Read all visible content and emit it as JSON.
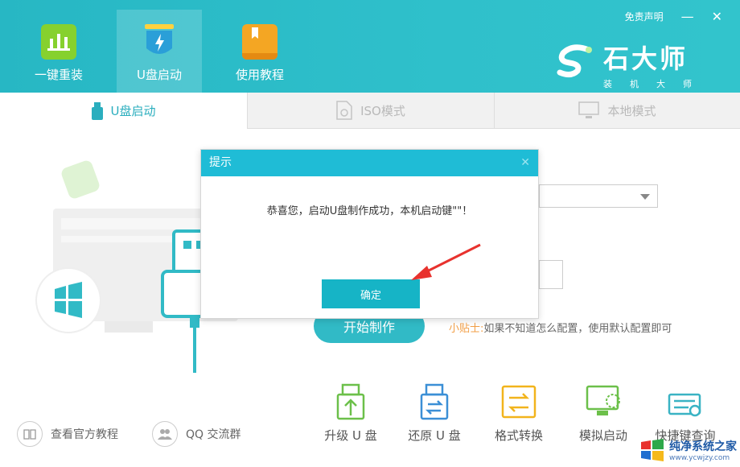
{
  "nav": [
    {
      "label": "一键重装",
      "icon": "bar-chart-icon",
      "color": "#7fcf2f"
    },
    {
      "label": "U盘启动",
      "icon": "usb-shield-icon",
      "color": "#2ab5e0"
    },
    {
      "label": "使用教程",
      "icon": "book-icon",
      "color": "#f5a623"
    }
  ],
  "topbar": {
    "disclaimer": "免责声明",
    "minimize": "—",
    "close": "✕"
  },
  "brand": {
    "name": "石大师",
    "sub": "装机大师"
  },
  "tabs": [
    {
      "label": "U盘启动",
      "icon": "usb-drive-icon"
    },
    {
      "label": "ISO模式",
      "icon": "iso-file-icon"
    },
    {
      "label": "本地模式",
      "icon": "monitor-icon"
    }
  ],
  "start_button": "开始制作",
  "tip": {
    "label": "小贴士:",
    "text": "如果不知道怎么配置，使用默认配置即可"
  },
  "footer": {
    "tutorial": "查看官方教程",
    "qq_group": "QQ 交流群"
  },
  "tools": [
    {
      "label": "升级 U 盘",
      "icon": "upgrade-usb-icon"
    },
    {
      "label": "还原 U 盘",
      "icon": "restore-usb-icon"
    },
    {
      "label": "格式转换",
      "icon": "format-convert-icon"
    },
    {
      "label": "模拟启动",
      "icon": "simulate-boot-icon"
    },
    {
      "label": "快捷键查询",
      "icon": "shortcut-query-icon"
    }
  ],
  "dialog": {
    "title": "提示",
    "close": "✕",
    "message": "恭喜您，启动U盘制作成功，本机启动键\"\"！",
    "ok": "确定"
  },
  "watermark": {
    "name": "纯净系统之家",
    "url": "www.ycwjzy.com"
  },
  "colors": {
    "accent": "#31bac6",
    "dialog_header": "#1fbcd6",
    "tip_label": "#f29f47"
  }
}
